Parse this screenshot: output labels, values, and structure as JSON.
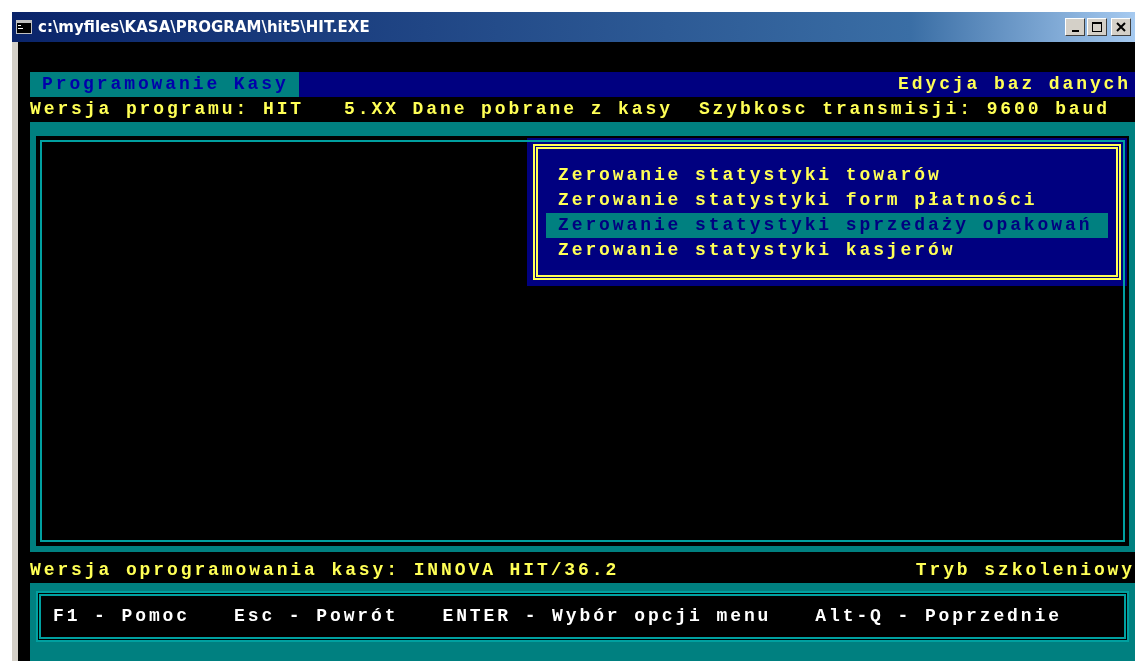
{
  "window": {
    "title": "c:\\myfiles\\KASA\\PROGRAM\\hit5\\HIT.EXE"
  },
  "header": {
    "left": "Programowanie Kasy",
    "right": "Edycja baz danych"
  },
  "info_line": [
    "Wersja programu: HIT",
    "5.XX Dane pobrane z kasy",
    "Szybkosc transmisji: 9600 baud"
  ],
  "menu": {
    "items": [
      {
        "label": "Zerowanie statystyki towarów",
        "selected": false
      },
      {
        "label": "Zerowanie statystyki form płatności",
        "selected": false
      },
      {
        "label": "Zerowanie statystyki sprzedaży opakowań",
        "selected": true
      },
      {
        "label": "Zerowanie statystyki kasjerów",
        "selected": false
      }
    ]
  },
  "status_line": {
    "left": "Wersja oprogramowania kasy: INNOVA HIT/36.2",
    "right": "Tryb szkoleniowy"
  },
  "key_hints": [
    "F1 - Pomoc",
    "Esc - Powrót",
    "ENTER - Wybór opcji menu",
    "Alt-Q - Poprzednie"
  ]
}
